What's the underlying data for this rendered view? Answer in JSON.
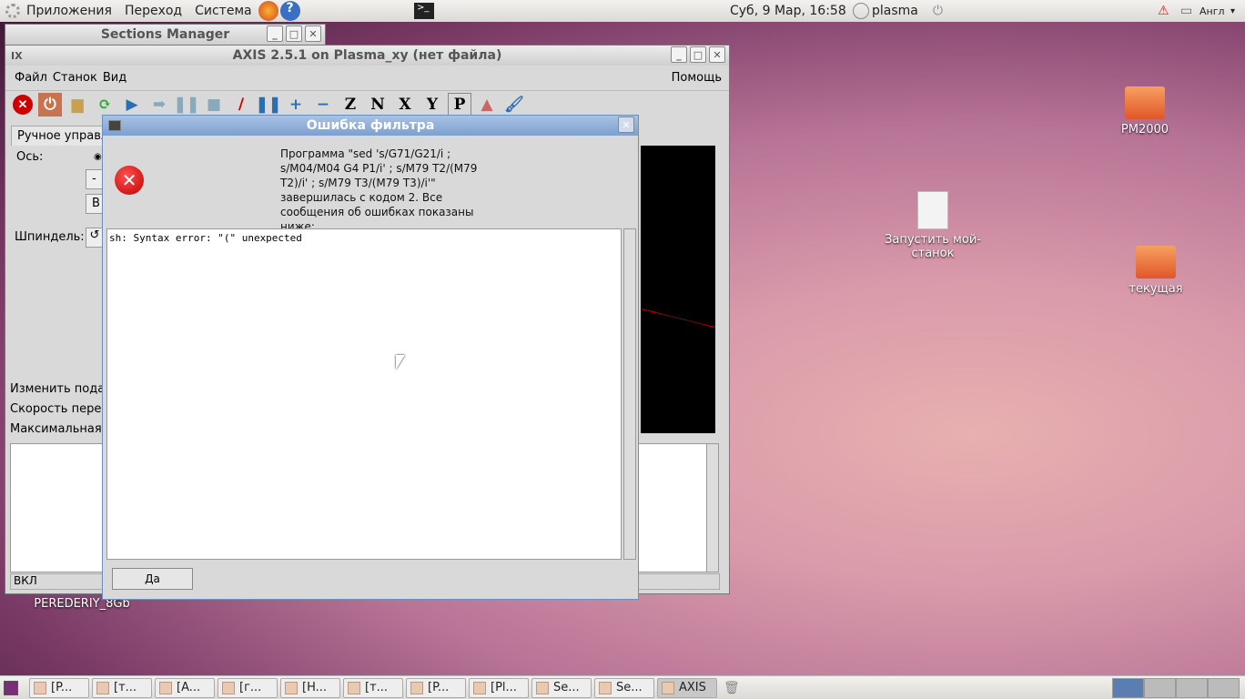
{
  "top_panel": {
    "menus": [
      "Приложения",
      "Переход",
      "Система"
    ],
    "clock": "Суб,  9 Мар, 16:58",
    "user": "plasma",
    "keyboard": "Англ"
  },
  "sections_manager": {
    "title": "Sections Manager"
  },
  "axis": {
    "title": "AXIS 2.5.1 on Plasma_xy (нет файла)",
    "menu": [
      "Файл",
      "Станок",
      "Вид"
    ],
    "help": "Помощь",
    "toolbar": [
      "Z",
      "N",
      "X",
      "Y",
      "P"
    ],
    "tab": "Ручное управл",
    "axis_label": "Ось:",
    "spindle_label": "Шпиндель:",
    "btn1": "-",
    "btn2": "В",
    "feed": "Изменить подач",
    "speed": "Скорость перем",
    "max": "Максимальная с",
    "status": "ВКЛ"
  },
  "dialog": {
    "title": "Ошибка фильтра",
    "message": "Программа \"sed 's/G71/G21/i ; s/M04/M04 G4 P1/i' ; s/M79 T2/(M79 T2)/i' ; s/M79 T3/(M79 T3)/i'\" завершилась с кодом 2.  Все сообщения об ошибках показаны ниже:",
    "output": "sh: Syntax error: \"(\" unexpected",
    "ok": "Да"
  },
  "desktop": {
    "icons": [
      "PM2000",
      "Запустить мой-станок",
      "текущая",
      "PEREDERIY_8Gb"
    ]
  },
  "taskbar": {
    "items": [
      "[P...",
      "[т...",
      "[A...",
      "[г...",
      "[H...",
      "[т...",
      "[P...",
      "[Pl...",
      "Se...",
      "Se...",
      "AXIS"
    ]
  }
}
